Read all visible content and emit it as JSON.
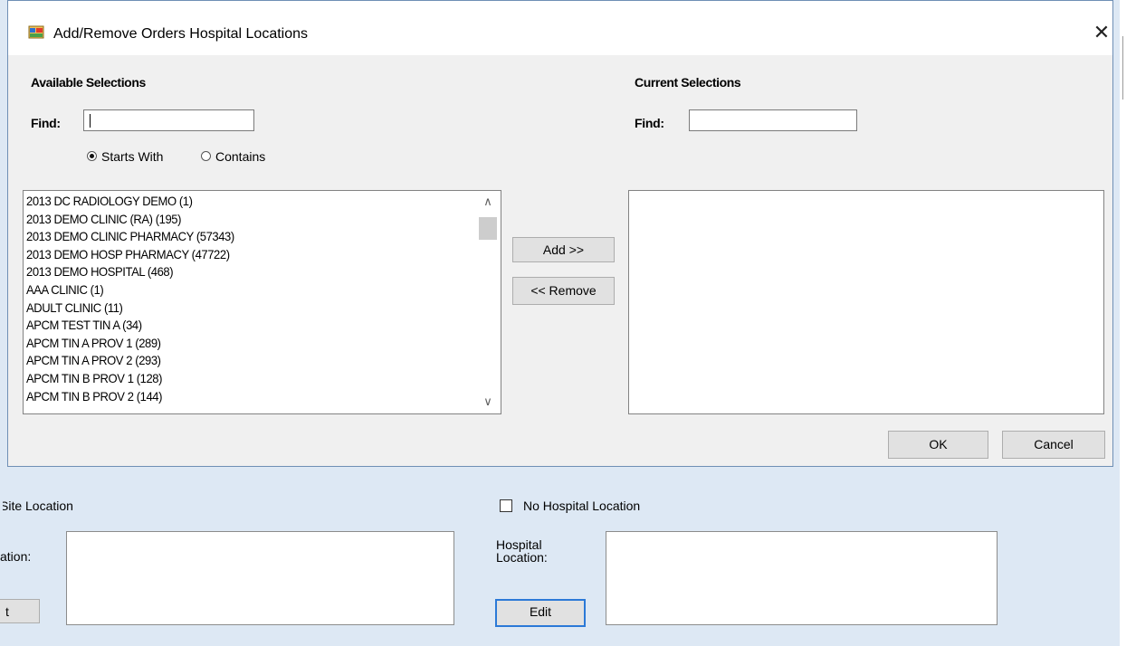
{
  "dialog": {
    "title": "Add/Remove Orders Hospital Locations",
    "close_glyph": "✕",
    "available": {
      "heading": "Available Selections",
      "find_label": "Find:",
      "find_value": "",
      "radio_starts_with": "Starts With",
      "radio_contains": "Contains",
      "selected_mode": "starts_with",
      "items": [
        "2013 DC RADIOLOGY DEMO (1)",
        "2013 DEMO CLINIC (RA) (195)",
        "2013 DEMO CLINIC PHARMACY (57343)",
        "2013 DEMO HOSP PHARMACY (47722)",
        "2013 DEMO HOSPITAL (468)",
        "AAA CLINIC (1)",
        "ADULT CLINIC (11)",
        "APCM TEST TIN A (34)",
        "APCM TIN A PROV 1 (289)",
        "APCM TIN A PROV 2 (293)",
        "APCM TIN B PROV 1 (128)",
        "APCM TIN B PROV 2 (144)"
      ]
    },
    "current": {
      "heading": "Current Selections",
      "find_label": "Find:",
      "find_value": "",
      "items": []
    },
    "add_label": "Add >>",
    "remove_label": "<< Remove",
    "ok_label": "OK",
    "cancel_label": "Cancel"
  },
  "background": {
    "site_location_label": "Site Location",
    "location_label": "ation:",
    "no_hospital_location_label": "No Hospital Location",
    "no_hospital_location_checked": false,
    "hospital_location_label_line1": "Hospital",
    "hospital_location_label_line2": "Location:",
    "left_button_label": "t",
    "edit_label": "Edit"
  },
  "colors": {
    "dialog_bg": "#f0f0f0",
    "window_bg": "#dde8f4",
    "accent_focus": "#2b79d7"
  }
}
